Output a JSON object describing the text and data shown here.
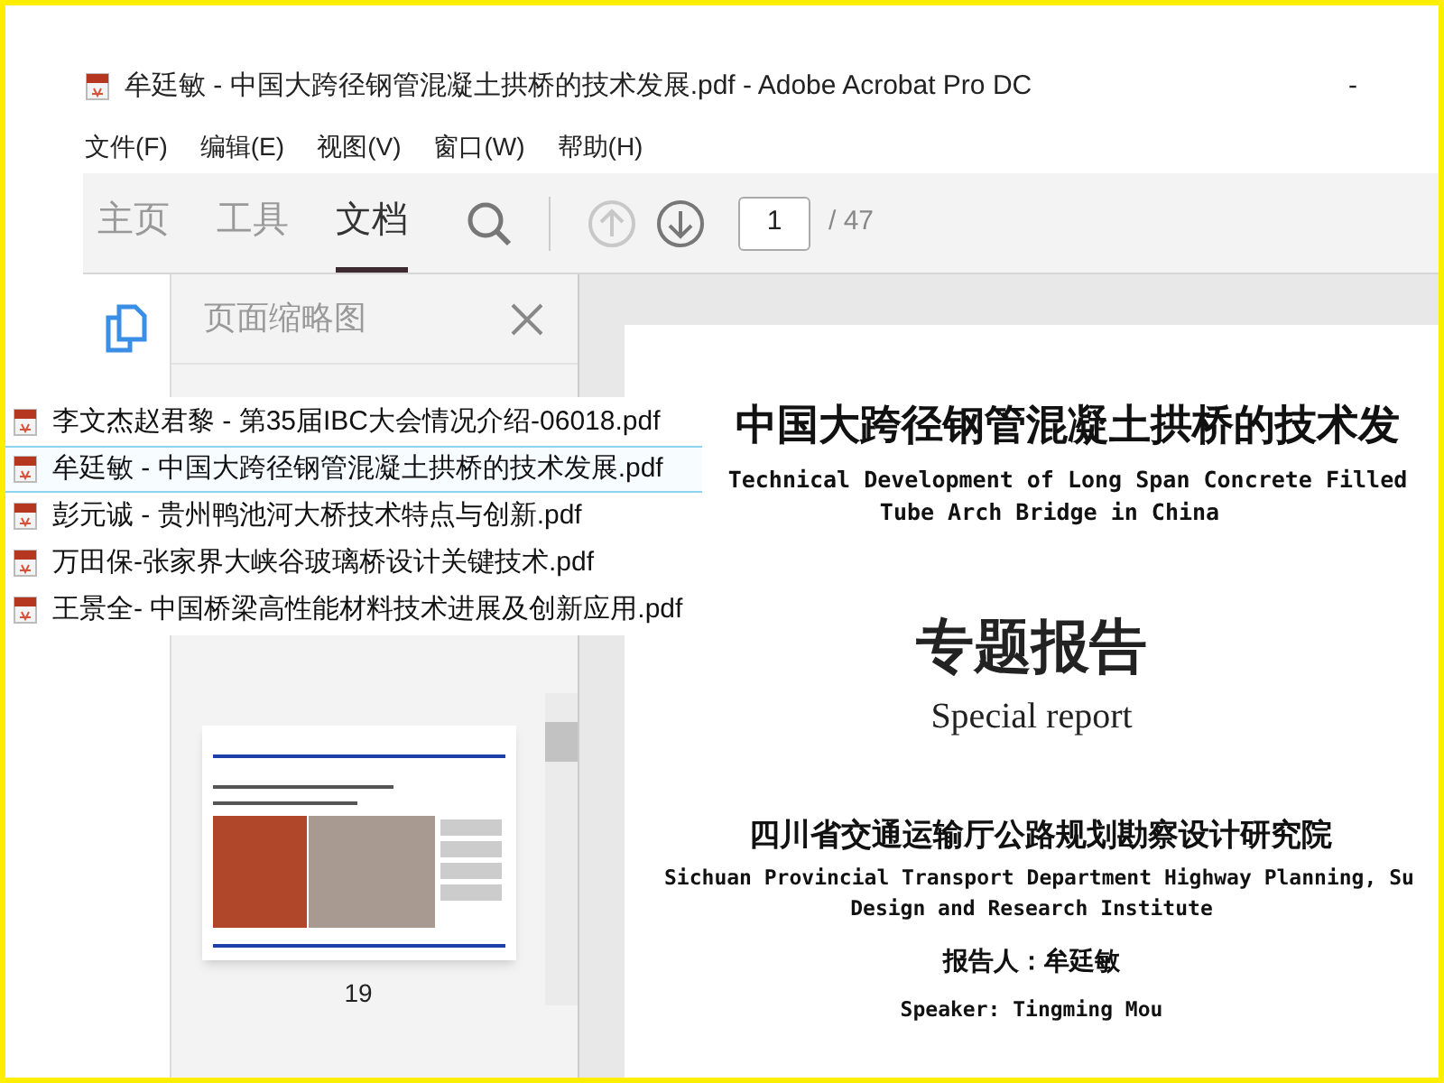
{
  "window": {
    "title": "牟廷敏 - 中国大跨径钢管混凝土拱桥的技术发展.pdf - Adobe Acrobat Pro DC",
    "minimize": "-"
  },
  "menu": [
    "文件(F)",
    "编辑(E)",
    "视图(V)",
    "窗口(W)",
    "帮助(H)"
  ],
  "tabs": [
    {
      "label": "主页",
      "selected": false
    },
    {
      "label": "工具",
      "selected": false
    },
    {
      "label": "文档",
      "selected": true
    }
  ],
  "page_nav": {
    "previous_disabled": true,
    "current": "1",
    "total": "/ 47"
  },
  "panel": {
    "title": "页面缩略图",
    "thumbnail_label": "19"
  },
  "file_list": [
    {
      "label": "李文杰赵君黎 - 第35届IBC大会情况介绍-06018.pdf",
      "selected": false
    },
    {
      "label": "牟廷敏 - 中国大跨径钢管混凝土拱桥的技术发展.pdf",
      "selected": true
    },
    {
      "label": "彭元诚 - 贵州鸭池河大桥技术特点与创新.pdf",
      "selected": false
    },
    {
      "label": "万田保-张家界大峡谷玻璃桥设计关键技术.pdf",
      "selected": false
    },
    {
      "label": "王景全- 中国桥梁高性能材料技术进展及创新应用.pdf",
      "selected": false
    }
  ],
  "document": {
    "title": "中国大跨径钢管混凝土拱桥的技术发",
    "subtitle_line_1": "Technical Development of Long Span Concrete Filled",
    "subtitle_line_2": "Tube Arch Bridge in China",
    "heading": "专题报告",
    "heading_en": "Special report",
    "institute": "四川省交通运输厅公路规划勘察设计研究院",
    "institute_en_line_1": "Sichuan Provincial Transport Department Highway Planning, Su",
    "institute_en_line_2": "Design and Research Institute",
    "speaker": "报告人：牟廷敏",
    "speaker_en": "Speaker: Tingming Mou"
  }
}
